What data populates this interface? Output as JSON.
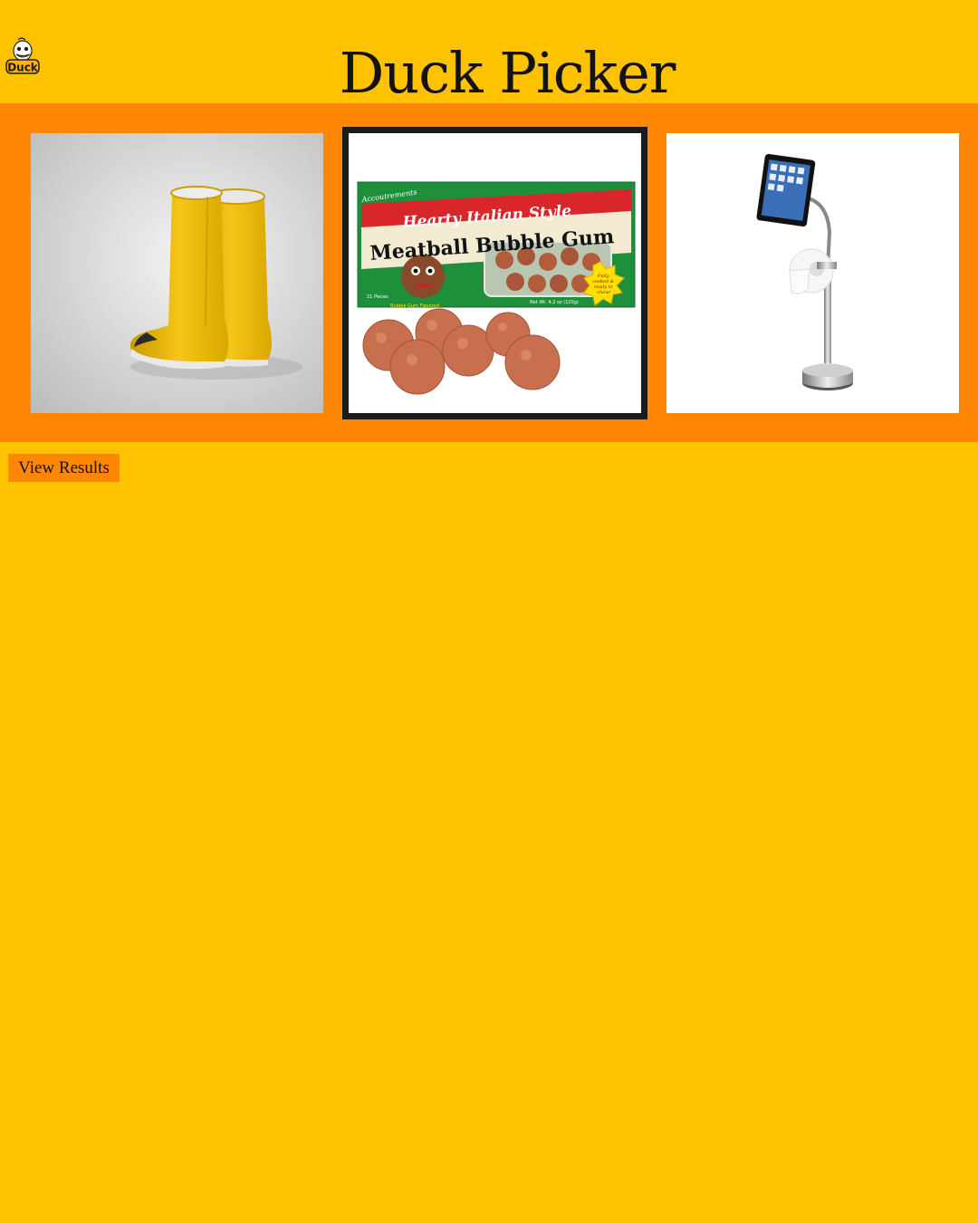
{
  "header": {
    "logo_text": "Duck",
    "title": "Duck Picker"
  },
  "products": [
    {
      "name": "yellow-rain-boots",
      "selected": false
    },
    {
      "name": "meatball-bubble-gum",
      "selected": true,
      "package_brand": "Accoutrements",
      "package_title_1": "Hearty Italian Style",
      "package_title_2": "Meatball Bubble Gum",
      "package_pieces": "21 Pieces",
      "package_flavor": "Bubble Gum Flavored",
      "package_weight": "Net Wt. 4.2 oz (120g)",
      "package_starburst": [
        "Fully",
        "cooked &",
        "ready to",
        "chew!"
      ]
    },
    {
      "name": "tablet-toilet-paper-stand",
      "selected": false
    }
  ],
  "actions": {
    "view_results_label": "View Results"
  },
  "colors": {
    "page_background": "#ffc200",
    "band_background": "#ff8704",
    "button_background": "#ff8704",
    "selected_border": "#1b1b1b"
  }
}
